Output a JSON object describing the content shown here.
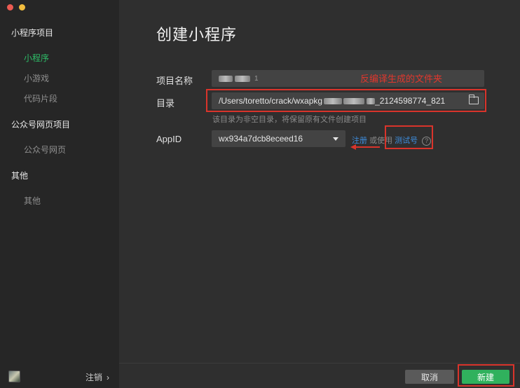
{
  "sidebar": {
    "sections": [
      {
        "title": "小程序项目",
        "items": [
          "小程序",
          "小游戏",
          "代码片段"
        ]
      },
      {
        "title": "公众号网页项目",
        "items": [
          "公众号网页"
        ]
      },
      {
        "title": "其他",
        "items": [
          "其他"
        ]
      }
    ],
    "logout_label": "注销",
    "logout_chevron": "›"
  },
  "page": {
    "title": "创建小程序",
    "project_name": {
      "label": "项目名称",
      "value_suffix": "1"
    },
    "annotation": "反编译生成的文件夹",
    "directory": {
      "label": "目录",
      "value_start": "/Users/toretto/crack/wxapkg",
      "value_end": "_2124598774_821",
      "hint": "该目录为非空目录，将保留原有文件创建项目"
    },
    "appid": {
      "label": "AppID",
      "value": "wx934a7dcb8eceed16",
      "register": "注册",
      "or_use": "或使用",
      "test_account": "测试号",
      "help": "?"
    }
  },
  "footer": {
    "cancel": "取消",
    "create": "新建"
  },
  "colors": {
    "accent_green": "#2ebd68",
    "button_green": "#30b15d",
    "link_blue": "#3e8fe0",
    "annotation_red": "#d9342b"
  }
}
